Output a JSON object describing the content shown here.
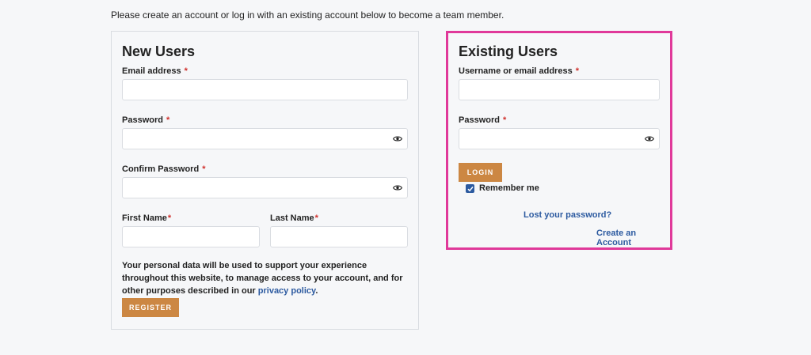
{
  "intro_text": "Please create an account or log in with an existing account below to become a team member.",
  "new_users": {
    "title": "New Users",
    "email_label": "Email address",
    "password_label": "Password",
    "confirm_password_label": "Confirm Password",
    "first_name_label": "First Name",
    "last_name_label": "Last Name",
    "required_marker": "*",
    "privacy_text": "Your personal data will be used to support your experience throughout this website, to manage access to your account, and for other purposes described in our",
    "privacy_link": "privacy policy",
    "privacy_end": ".",
    "register_label": "REGISTER"
  },
  "existing_users": {
    "title": "Existing Users",
    "username_label": "Username or email address",
    "password_label": "Password",
    "required_marker": "*",
    "login_label": "LOGIN",
    "remember_label": "Remember me",
    "remember_checked": true,
    "lost_password": "Lost your password?",
    "create_account": "Create an Account"
  },
  "icons": {
    "show_password": "eye-icon",
    "checkmark": "checkmark-icon"
  },
  "colors": {
    "accent_button": "#cc8743",
    "link": "#2c5aa0",
    "highlight_border": "#e0399a",
    "required": "#d0312d"
  }
}
